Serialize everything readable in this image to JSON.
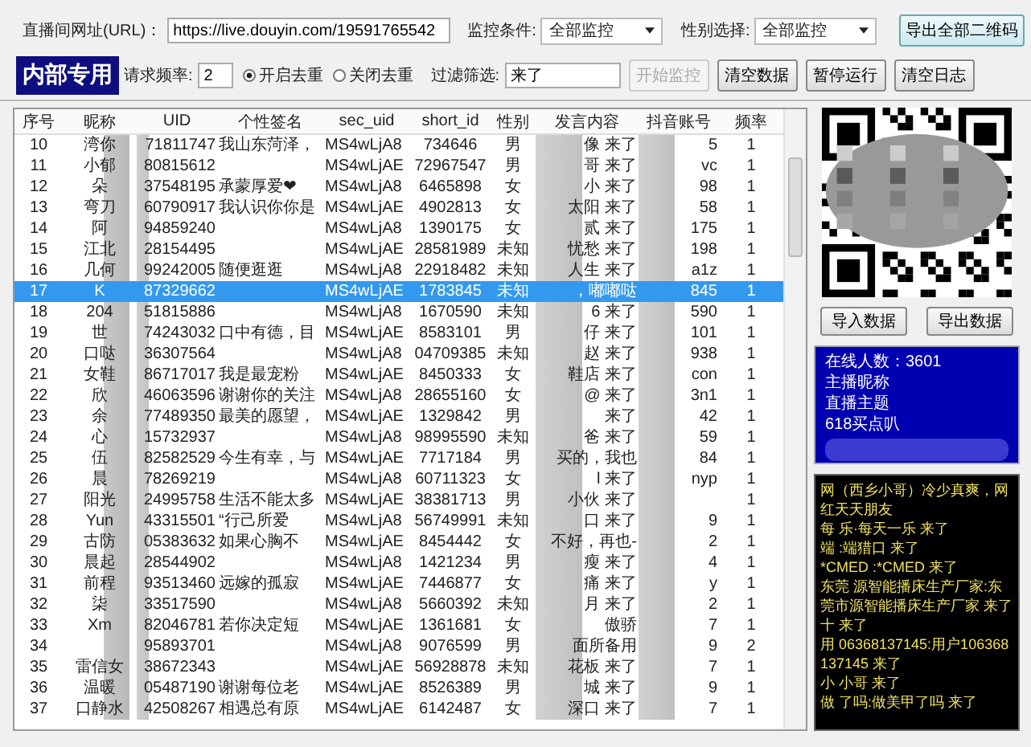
{
  "top_bar": {
    "url_label": "直播间网址(URL)：",
    "url_value": "https://live.douyin.com/19591765542",
    "monitor_label": "监控条件:",
    "monitor_value": "全部监控",
    "gender_label": "性别选择:",
    "gender_value": "全部监控",
    "export_qr_button": "导出全部二维码"
  },
  "second_bar": {
    "badge": "内部专用",
    "freq_label": "请求频率:",
    "freq_value": "2",
    "dedup_options": [
      {
        "label": "开启去重",
        "selected": true
      },
      {
        "label": "关闭去重",
        "selected": false
      }
    ],
    "filter_label": "过滤筛选:",
    "filter_value": "来了",
    "buttons": [
      {
        "label": "开始监控",
        "disabled": true
      },
      {
        "label": "清空数据",
        "disabled": false
      },
      {
        "label": "暂停运行",
        "disabled": false
      },
      {
        "label": "清空日志",
        "disabled": false
      }
    ]
  },
  "table": {
    "columns": [
      "序号",
      "昵称",
      "UID",
      "个性签名",
      "sec_uid",
      "short_id",
      "性别",
      "发言内容",
      "抖音账号",
      "频率"
    ],
    "rows": [
      {
        "selected": false,
        "cells": [
          "10",
          "湾你",
          "71811747",
          "我山东菏泽，",
          "MS4wLjA8",
          "734646",
          "男",
          "像 来了",
          "5",
          "1"
        ]
      },
      {
        "selected": false,
        "cells": [
          "11",
          "小郁",
          "80815612",
          "",
          "MS4wLjAE",
          "72967547",
          "男",
          "哥 来了",
          "vc",
          "1"
        ]
      },
      {
        "selected": false,
        "cells": [
          "12",
          "朵",
          "37548195",
          "承蒙厚爱❤",
          "MS4wLjA8",
          "6465898",
          "女",
          "小 来了",
          "98",
          "1"
        ]
      },
      {
        "selected": false,
        "cells": [
          "13",
          "弯刀",
          "60790917",
          "我认识你你是",
          "MS4wLjAE",
          "4902813",
          "女",
          "太阳 来了",
          "58",
          "1"
        ]
      },
      {
        "selected": false,
        "cells": [
          "14",
          "阿",
          "94859240",
          "",
          "MS4wLjA8",
          "1390175",
          "女",
          "贰 来了",
          "175",
          "1"
        ]
      },
      {
        "selected": false,
        "cells": [
          "15",
          "江北",
          "28154495",
          "",
          "MS4wLjAE",
          "28581989",
          "未知",
          "忧愁 来了",
          "198",
          "1"
        ]
      },
      {
        "selected": false,
        "cells": [
          "16",
          "几何",
          "99242005",
          "随便逛逛",
          "MS4wLjA8",
          "22918482",
          "未知",
          "人生 来了",
          "a1z",
          "1"
        ]
      },
      {
        "selected": true,
        "cells": [
          "17",
          "K",
          "87329662",
          "",
          "MS4wLjAE",
          "1783845",
          "未知",
          "，嘟嘟哒",
          "845",
          "1"
        ]
      },
      {
        "selected": false,
        "cells": [
          "18",
          "204",
          "51815886",
          "",
          "MS4wLjA8",
          "1670590",
          "未知",
          "6 来了",
          "590",
          "1"
        ]
      },
      {
        "selected": false,
        "cells": [
          "19",
          "世",
          "74243032",
          "口中有德，目",
          "MS4wLjAE",
          "8583101",
          "男",
          "仔 来了",
          "101",
          "1"
        ]
      },
      {
        "selected": false,
        "cells": [
          "20",
          "口哒",
          "36307564",
          "",
          "MS4wLjA8",
          "04709385",
          "未知",
          "赵 来了",
          "938",
          "1"
        ]
      },
      {
        "selected": false,
        "cells": [
          "21",
          "女鞋",
          "86717017",
          "我是最宠粉",
          "MS4wLjAE",
          "8450333",
          "女",
          "鞋店 来了",
          "con",
          "1"
        ]
      },
      {
        "selected": false,
        "cells": [
          "22",
          "欣",
          "46063596",
          "谢谢你的关注",
          "MS4wLjA8",
          "28655160",
          "女",
          "@ 来了",
          "3n1",
          "1"
        ]
      },
      {
        "selected": false,
        "cells": [
          "23",
          "余",
          "77489350",
          "最美的愿望，",
          "MS4wLjAE",
          "1329842",
          "男",
          "来了",
          "42",
          "1"
        ]
      },
      {
        "selected": false,
        "cells": [
          "24",
          "心",
          "15732937",
          "",
          "MS4wLjA8",
          "98995590",
          "未知",
          "爸 来了",
          "59",
          "1"
        ]
      },
      {
        "selected": false,
        "cells": [
          "25",
          "伍",
          "82582529",
          "今生有幸，与",
          "MS4wLjAE",
          "7717184",
          "男",
          "买的，我也",
          "84",
          "1"
        ]
      },
      {
        "selected": false,
        "cells": [
          "26",
          "晨",
          "78269219",
          "",
          "MS4wLjA8",
          "60711323",
          "女",
          "l 来了",
          "nyp",
          "1"
        ]
      },
      {
        "selected": false,
        "cells": [
          "27",
          "阳光",
          "24995758",
          "生活不能太多",
          "MS4wLjAE",
          "38381713",
          "男",
          "小伙 来了",
          "",
          "1"
        ]
      },
      {
        "selected": false,
        "cells": [
          "28",
          "Yun",
          "43315501",
          "“行己所爱",
          "MS4wLjA8",
          "56749991",
          "未知",
          "口 来了",
          "9",
          "1"
        ]
      },
      {
        "selected": false,
        "cells": [
          "29",
          "古防",
          "05383632",
          "如果心胸不",
          "MS4wLjAE",
          "8454442",
          "女",
          "不好，再也-",
          "2",
          "1"
        ]
      },
      {
        "selected": false,
        "cells": [
          "30",
          "晨起",
          "28544902",
          "",
          "MS4wLjA8",
          "1421234",
          "男",
          "瘦 来了",
          "4",
          "1"
        ]
      },
      {
        "selected": false,
        "cells": [
          "31",
          "前程",
          "93513460",
          "远嫁的孤寂",
          "MS4wLjAE",
          "7446877",
          "女",
          "痛 来了",
          "y",
          "1"
        ]
      },
      {
        "selected": false,
        "cells": [
          "32",
          "柒",
          "33517590",
          "",
          "MS4wLjA8",
          "5660392",
          "未知",
          "月 来了",
          "2",
          "1"
        ]
      },
      {
        "selected": false,
        "cells": [
          "33",
          "Xm",
          "82046781",
          "若你决定短",
          "MS4wLjAE",
          "1361681",
          "女",
          "傲骄",
          "7",
          "1"
        ]
      },
      {
        "selected": false,
        "cells": [
          "34",
          "",
          "95893701",
          "",
          "MS4wLjA8",
          "9076599",
          "男",
          "面所备用",
          "9",
          "2"
        ]
      },
      {
        "selected": false,
        "cells": [
          "35",
          "雷信女",
          "38672343",
          "",
          "MS4wLjAE",
          "56928878",
          "未知",
          "花板 来了",
          "7",
          "1"
        ]
      },
      {
        "selected": false,
        "cells": [
          "36",
          "温暖",
          "05487190",
          "谢谢每位老",
          "MS4wLjAE",
          "8526389",
          "男",
          "城 来了",
          "9",
          "1"
        ]
      },
      {
        "selected": false,
        "cells": [
          "37",
          "口静水",
          "42508267",
          "相遇总有原",
          "MS4wLjAE",
          "6142487",
          "女",
          "深口 来了",
          "7",
          "1"
        ]
      }
    ]
  },
  "side": {
    "import_button": "导入数据",
    "export_button": "导出数据",
    "info_lines": [
      "在线人数：3601",
      "主播昵称",
      "直播主题",
      "618买点叭"
    ],
    "log_lines": [
      "网（西乡小哥）冷少真爽，网红天天朋友",
      "每 乐·每天一乐 来了",
      "端 :端猎口 来了",
      "*CMED :*CMED 来了",
      "东莞 源智能播床生产厂家:东莞市源智能播床生产厂家 来了",
      "十 来了",
      "用 06368137145:用户106368137145 来了",
      "小 小哥 来了",
      "做 了吗:做美甲了吗 来了"
    ]
  }
}
